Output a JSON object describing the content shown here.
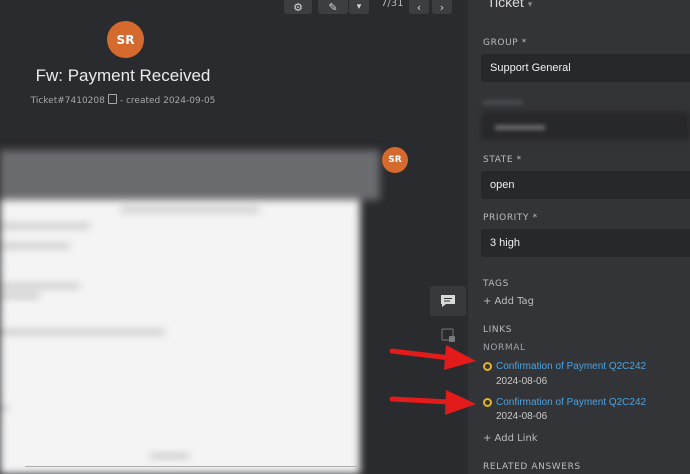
{
  "toolbar": {
    "counter": "7/31"
  },
  "ticket": {
    "avatar_initials": "SR",
    "title": "Fw: Payment Received",
    "number": "Ticket#7410208",
    "created": "- created 2024-09-05"
  },
  "article": {
    "avatar_initials": "SR"
  },
  "sidebar": {
    "header": "Ticket",
    "group": {
      "label": "GROUP *",
      "value": "Support General"
    },
    "state": {
      "label": "STATE *",
      "value": "open"
    },
    "priority": {
      "label": "PRIORITY *",
      "value": "3 high"
    },
    "tags": {
      "label": "TAGS",
      "add": "+ Add Tag"
    },
    "links": {
      "label": "LINKS",
      "category": "NORMAL",
      "items": [
        {
          "title": "Confirmation of Payment Q2C242",
          "date": "2024-08-06"
        },
        {
          "title": "Confirmation of Payment Q2C242",
          "date": "2024-08-06"
        }
      ],
      "add": "+ Add Link"
    },
    "related_answers": {
      "label": "RELATED ANSWERS"
    }
  },
  "colors": {
    "accent_orange": "#d46a2d",
    "link_blue": "#4aa3e0",
    "status_yellow": "#e6b322",
    "arrow_red": "#e31b1b"
  }
}
